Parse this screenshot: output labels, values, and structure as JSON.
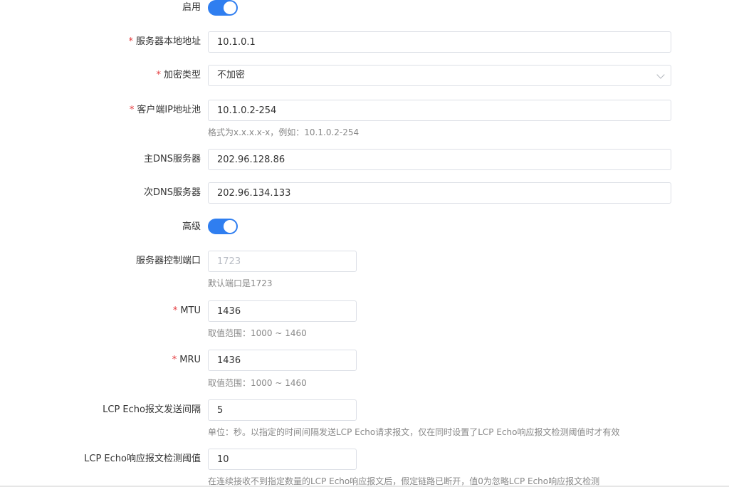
{
  "enable": {
    "label": "启用",
    "on": true
  },
  "server_local_address": {
    "label": "服务器本地地址",
    "required": true,
    "value": "10.1.0.1"
  },
  "encryption_type": {
    "label": "加密类型",
    "required": true,
    "value": "不加密"
  },
  "client_ip_pool": {
    "label": "客户端IP地址池",
    "required": true,
    "value": "10.1.0.2-254",
    "hint": "格式为x.x.x.x-x，例如：10.1.0.2-254"
  },
  "primary_dns": {
    "label": "主DNS服务器",
    "value": "202.96.128.86"
  },
  "secondary_dns": {
    "label": "次DNS服务器",
    "value": "202.96.134.133"
  },
  "advanced": {
    "label": "高级",
    "on": true
  },
  "control_port": {
    "label": "服务器控制端口",
    "placeholder": "1723",
    "hint": "默认端口是1723"
  },
  "mtu": {
    "label": "MTU",
    "required": true,
    "value": "1436",
    "hint": "取值范围：1000 ~ 1460"
  },
  "mru": {
    "label": "MRU",
    "required": true,
    "value": "1436",
    "hint": "取值范围：1000 ~ 1460"
  },
  "lcp_echo_interval": {
    "label": "LCP Echo报文发送间隔",
    "value": "5",
    "hint": "单位：秒。以指定的时间间隔发送LCP Echo请求报文，仅在同时设置了LCP Echo响应报文检测阈值时才有效"
  },
  "lcp_echo_threshold": {
    "label": "LCP Echo响应报文检测阈值",
    "value": "10",
    "hint": "在连续接收不到指定数量的LCP Echo响应报文后，假定链路已断开，值0为忽略LCP Echo响应报文检测"
  },
  "colors": {
    "accent": "#2f7ef0",
    "required": "#e4393c"
  }
}
